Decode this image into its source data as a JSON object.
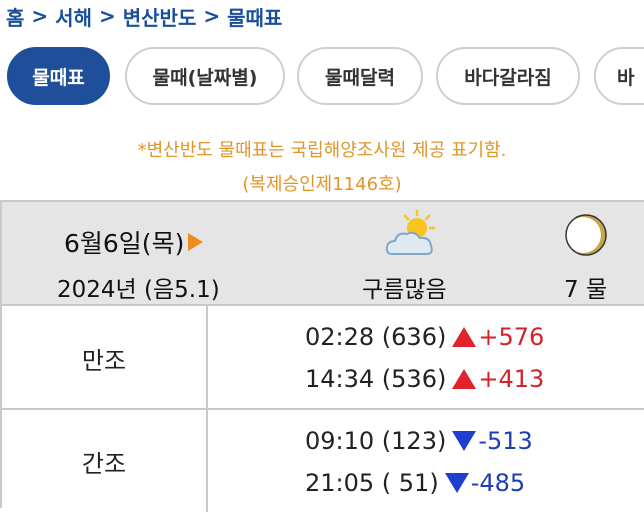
{
  "breadcrumb": {
    "items": [
      "홈",
      "서해",
      "변산반도",
      "물때표"
    ],
    "separator": ">"
  },
  "tabs": [
    {
      "label": "물때표",
      "active": true
    },
    {
      "label": "물때(날짜별)",
      "active": false
    },
    {
      "label": "물때달력",
      "active": false
    },
    {
      "label": "바다갈라짐",
      "active": false
    },
    {
      "label": "바",
      "active": false
    }
  ],
  "notice": {
    "line1": "*변산반도 물때표는 국립해양조사원 제공 표기함.",
    "line2": "(복제승인제1146호)"
  },
  "day": {
    "date": "6월6일(목)",
    "year_lunar": "2024년 (음5.1)",
    "weather": "구름많음",
    "weather_icon": "partly-cloudy-icon",
    "tide_phase": "7 물",
    "moon_icon": "crescent-moon-icon"
  },
  "high_tide": {
    "label": "만조",
    "entries": [
      {
        "time_level": "02:28 (636)",
        "change": "+576"
      },
      {
        "time_level": "14:34 (536)",
        "change": "+413"
      }
    ]
  },
  "low_tide": {
    "label": "간조",
    "entries": [
      {
        "time_level": "09:10 (123)",
        "change": "-513"
      },
      {
        "time_level": "21:05 ( 51)",
        "change": "-485"
      }
    ]
  },
  "colors": {
    "brand_blue": "#1f4e9a",
    "notice_orange": "#e0962a",
    "rise_red": "#d2232a",
    "fall_blue": "#1f3fb0"
  }
}
